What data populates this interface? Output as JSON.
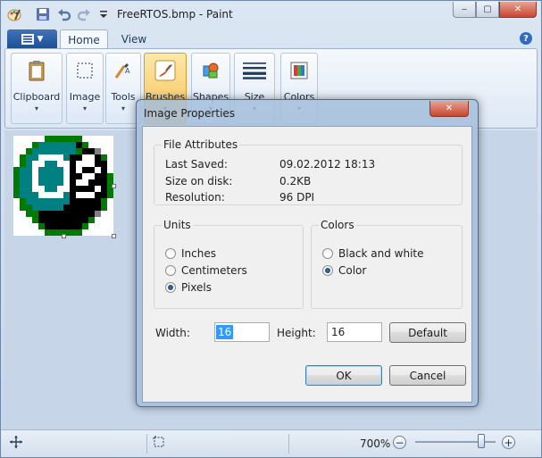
{
  "window": {
    "title": "FreeRTOS.bmp - Paint",
    "min_glyph": "‒",
    "max_glyph": "▢",
    "close_glyph": "✕"
  },
  "ribbon": {
    "tabs": [
      "Home",
      "View"
    ],
    "help_glyph": "?",
    "groups": [
      {
        "label": "Clipboard",
        "icon": "clipboard-icon"
      },
      {
        "label": "Image",
        "icon": "select-icon"
      },
      {
        "label": "Tools",
        "icon": "tools-icon"
      },
      {
        "label": "Brushes",
        "icon": "brush-icon"
      },
      {
        "label": "Shapes",
        "icon": "shapes-icon"
      },
      {
        "label": "Size",
        "icon": "size-icon"
      },
      {
        "label": "Colors",
        "icon": "colors-icon"
      }
    ],
    "dropdown_glyph": "▾"
  },
  "statusbar": {
    "zoom": "700%",
    "zoom_minus": "−",
    "zoom_plus": "+",
    "zoom_level": 0.82
  },
  "dialog": {
    "title": "Image Properties",
    "close_glyph": "✕",
    "file_attributes": {
      "title": "File Attributes",
      "rows": [
        {
          "label": "Last Saved:",
          "value": "09.02.2012 18:13"
        },
        {
          "label": "Size on disk:",
          "value": "0.2KB"
        },
        {
          "label": "Resolution:",
          "value": "96 DPI"
        }
      ]
    },
    "units": {
      "title": "Units",
      "options": [
        "Inches",
        "Centimeters",
        "Pixels"
      ],
      "selected": "Pixels"
    },
    "colors": {
      "title": "Colors",
      "options": [
        "Black and white",
        "Color"
      ],
      "selected": "Color"
    },
    "width_label": "Width:",
    "width_value": "16",
    "height_label": "Height:",
    "height_value": "16",
    "default_label": "Default",
    "ok_label": "OK",
    "cancel_label": "Cancel"
  },
  "colors": {
    "teal": "#008080",
    "black": "#000000",
    "white": "#ffffff",
    "green": "#007a00",
    "gray": "#808080",
    "silver": "#c0c0c0",
    "accent": "#3399ff"
  },
  "pixel_art": [
    "WWWWWGGGGGGWWWWW",
    "WWWGTTTTTTKGWWWW",
    "WWGTTTTTTTGKKSWW",
    "WGTTWWWWTKKWWKGW",
    "WGTWWTTWWKWWWKKW",
    "GTTWTTTTWKWKKWKW",
    "GTTWTTTTWKKWWKKG",
    "GTTWTTTTWKWWKKKG",
    "GTTWWTTWWKKKKWKG",
    "GTTTWWWWTKWWWKKG",
    "WGTTTTTTTKKKKKGW",
    "WGGTTTTTKKKKKKGW",
    "WWGGKKKKKKKKKSWW",
    "WWWGKKKKKKKKGWWW",
    "WWWWGKKKKKKGWWWW",
    "WWWWWGGGGGGWWWWW"
  ]
}
